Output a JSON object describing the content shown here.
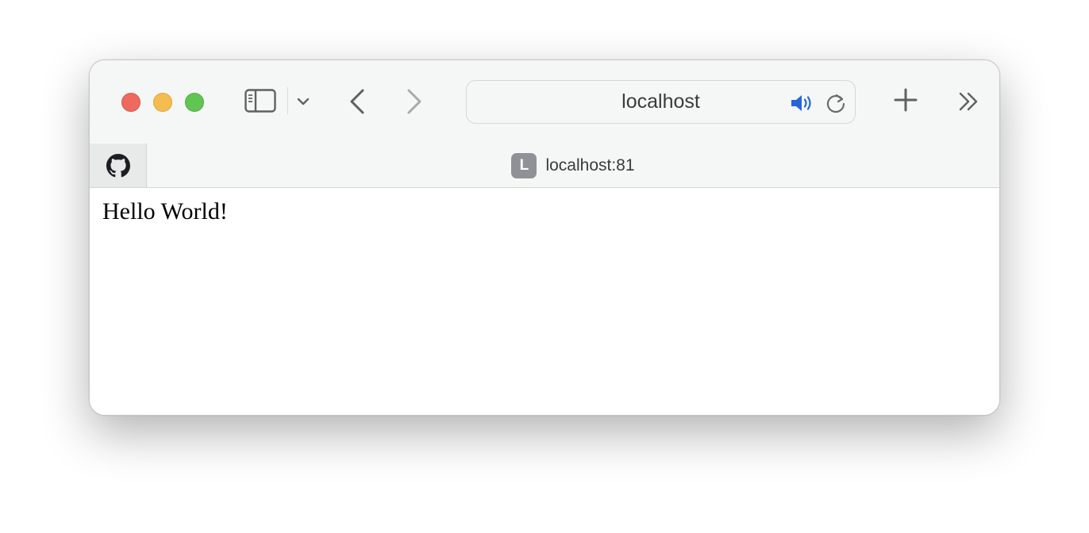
{
  "browser": {
    "address_bar": {
      "text": "localhost"
    },
    "tabs": [
      {
        "type": "pinned",
        "icon": "github-icon"
      },
      {
        "type": "active",
        "favicon_letter": "L",
        "title": "localhost:81"
      }
    ],
    "toolbar_icons": [
      "sidebar-icon",
      "chevron-down-icon",
      "back-arrow-icon",
      "forward-arrow-icon",
      "speaker-icon",
      "reload-icon",
      "plus-icon",
      "double-chevron-right-icon"
    ]
  },
  "colors": {
    "close": "#ee6a5e",
    "minimize": "#f5bd4f",
    "maximize": "#61c554",
    "speaker": "#2765d6",
    "favicon_bg": "#8f9197"
  },
  "page": {
    "body_text": "Hello World!"
  }
}
